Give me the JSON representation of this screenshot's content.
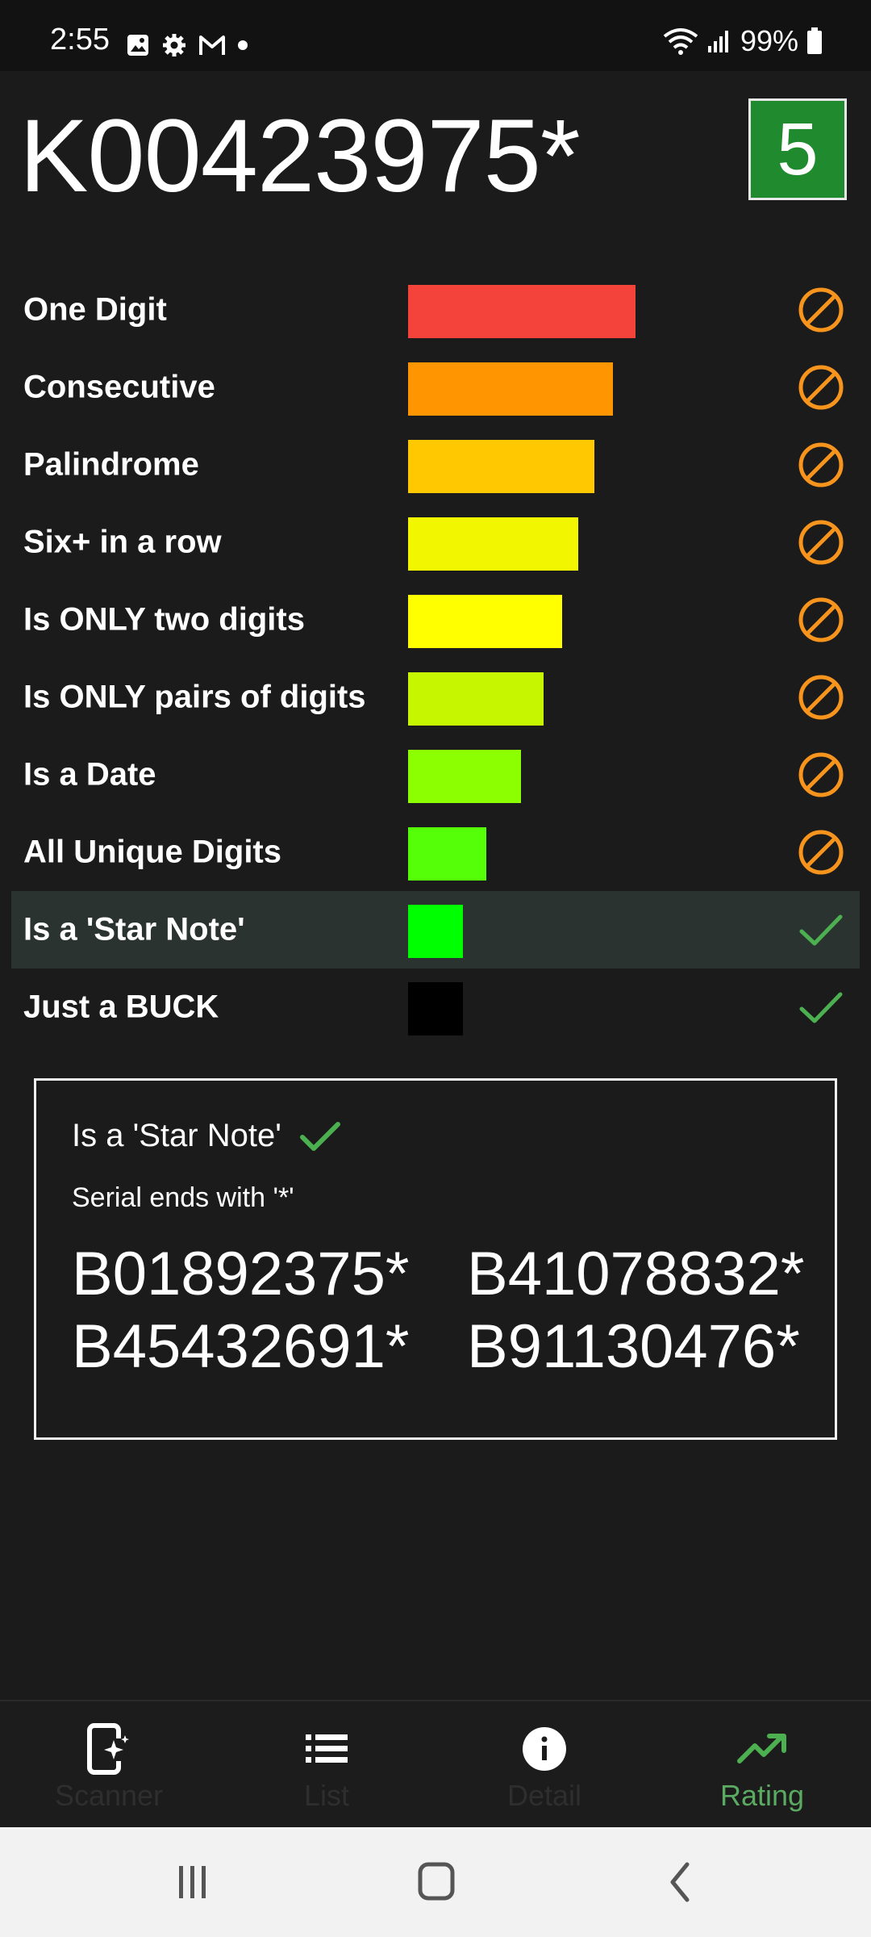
{
  "status_bar": {
    "time": "2:55",
    "battery": "99%",
    "left_icons": [
      "gallery-icon",
      "settings-gear-icon",
      "gmail-icon",
      "dot-icon"
    ],
    "right_icons": [
      "wifi-icon",
      "signal-icon",
      "battery-icon"
    ]
  },
  "header": {
    "serial": "K00423975*",
    "score": "5",
    "score_color": "#1f8a2e"
  },
  "ratings": [
    {
      "label": "One Digit",
      "bar_color": "#f4433a",
      "bar_level": 1.0,
      "result": "prohibited-icon"
    },
    {
      "label": "Consecutive",
      "bar_color": "#ff9500",
      "bar_level": 0.899,
      "result": "prohibited-icon"
    },
    {
      "label": "Palindrome",
      "bar_color": "#ffc800",
      "bar_level": 0.818,
      "result": "prohibited-icon"
    },
    {
      "label": "Six+ in a row",
      "bar_color": "#f2f700",
      "bar_level": 0.747,
      "result": "prohibited-icon"
    },
    {
      "label": "Is ONLY two digits",
      "bar_color": "#ffff00",
      "bar_level": 0.677,
      "result": "prohibited-icon"
    },
    {
      "label": "Is ONLY pairs of digits",
      "bar_color": "#c6f700",
      "bar_level": 0.596,
      "result": "prohibited-icon"
    },
    {
      "label": "Is a Date",
      "bar_color": "#8cff00",
      "bar_level": 0.495,
      "result": "prohibited-icon"
    },
    {
      "label": "All Unique Digits",
      "bar_color": "#55ff08",
      "bar_level": 0.343,
      "result": "prohibited-icon"
    },
    {
      "label": "Is a 'Star Note'",
      "bar_color": "#00ff00",
      "bar_level": 0.242,
      "result": "checkmark-icon",
      "highlighted": true
    },
    {
      "label": "Just a BUCK",
      "bar_color": "#000000",
      "bar_level": 0.242,
      "result": "checkmark-icon"
    }
  ],
  "detail_card": {
    "title": "Is a 'Star Note'",
    "subtitle": "Serial ends with '*'",
    "examples": [
      "B01892375*",
      "B41078832*",
      "B45432691*",
      "B91130476*"
    ]
  },
  "bottom_nav": {
    "items": [
      {
        "label": "Scanner",
        "icon": "scanner-phone-icon"
      },
      {
        "label": "List",
        "icon": "list-icon"
      },
      {
        "label": "Detail",
        "icon": "info-icon"
      },
      {
        "label": "Rating",
        "icon": "trending-up-icon",
        "active": true
      }
    ],
    "active_color": "#5aaa61"
  },
  "system_nav": {
    "buttons": [
      "recent-apps-icon",
      "home-icon",
      "back-icon"
    ]
  },
  "colors": {
    "background": "#1b1b1b",
    "prohibited": "#f7941d",
    "check": "#4caf50"
  }
}
